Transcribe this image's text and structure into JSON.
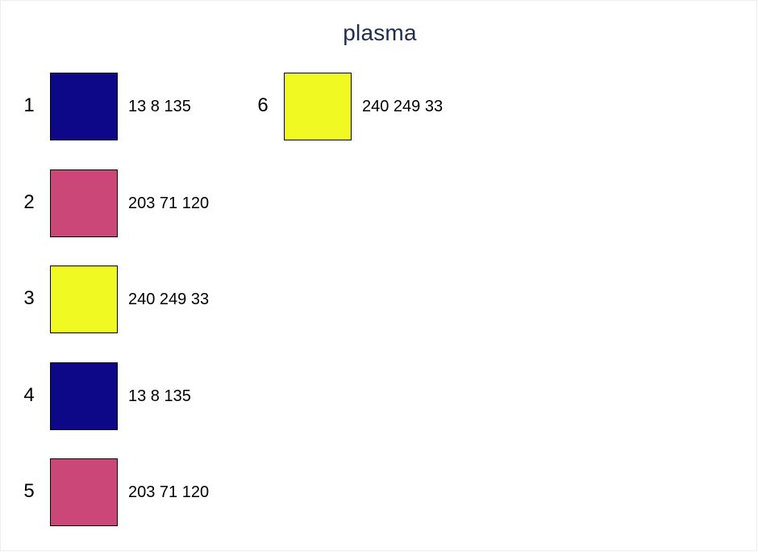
{
  "chart_data": {
    "type": "table",
    "title": "plasma",
    "swatches": [
      {
        "index": "1",
        "rgb": "13 8 135",
        "color": "#0d0887"
      },
      {
        "index": "2",
        "rgb": "203 71 120",
        "color": "#cb4778"
      },
      {
        "index": "3",
        "rgb": "240 249 33",
        "color": "#f0f921"
      },
      {
        "index": "4",
        "rgb": "13 8 135",
        "color": "#0d0887"
      },
      {
        "index": "5",
        "rgb": "203 71 120",
        "color": "#cb4778"
      },
      {
        "index": "6",
        "rgb": "240 249 33",
        "color": "#f0f921"
      }
    ]
  }
}
